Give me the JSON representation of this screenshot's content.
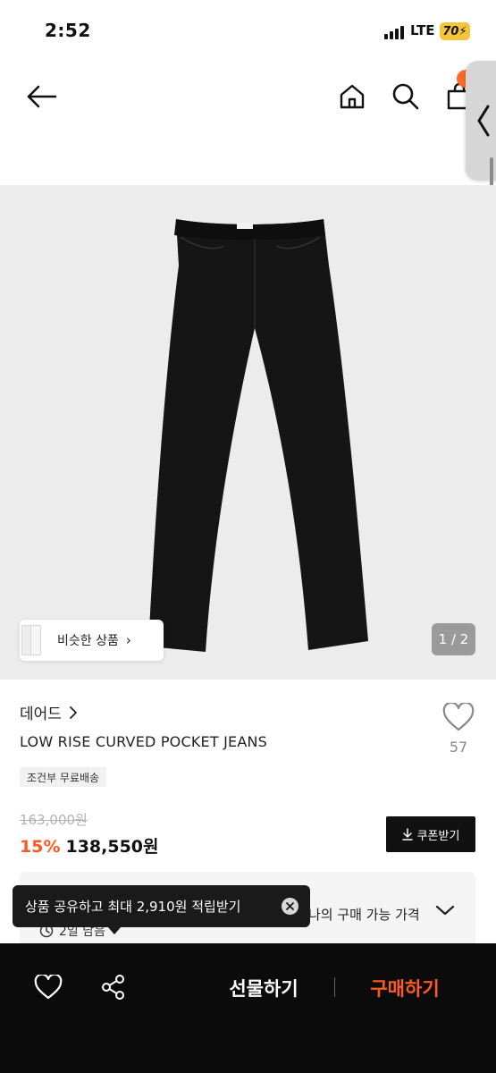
{
  "status_bar": {
    "time": "2:52",
    "network": "LTE",
    "battery": "70"
  },
  "header": {
    "icons": [
      "back-arrow-icon",
      "home-icon",
      "search-icon",
      "cart-icon"
    ],
    "accent_color": "#ff6a2b"
  },
  "product_image": {
    "similar_label": "비슷한 상품",
    "page_indicator": "1 / 2"
  },
  "product": {
    "brand": "데어드",
    "name": "LOW RISE CURVED POCKET JEANS",
    "like_count": "57",
    "shipping_badge": "조건부 무료배송",
    "original_price": "163,000원",
    "discount_rate": "15%",
    "sale_price": "138,550원",
    "coupon_label": "쿠폰받기"
  },
  "price_option": {
    "text": "나의 구매 가능 가격",
    "time_left": "2일 남음"
  },
  "toast": {
    "message": "상품 공유하고 최대 2,910원 적립받기"
  },
  "bottom_bar": {
    "gift_label": "선물하기",
    "buy_label": "구매하기",
    "buy_color": "#ff5a22"
  }
}
